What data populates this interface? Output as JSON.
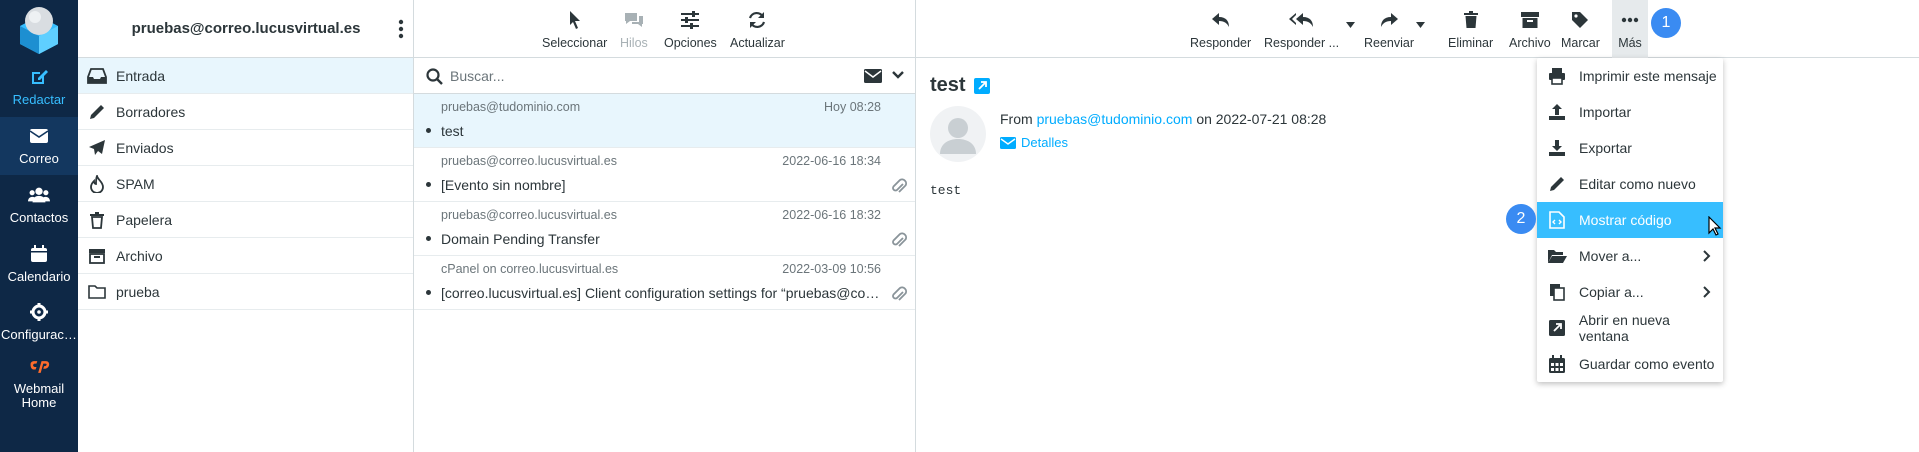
{
  "nav": {
    "compose": "Redactar",
    "mail": "Correo",
    "contacts": "Contactos",
    "calendar": "Calendario",
    "settings": "Configuraci...",
    "webmail_home": "Webmail Home"
  },
  "folders": {
    "account": "pruebas@correo.lucusvirtual.es",
    "items": [
      {
        "label": "Entrada",
        "icon": "inbox-icon"
      },
      {
        "label": "Borradores",
        "icon": "pencil-icon"
      },
      {
        "label": "Enviados",
        "icon": "paper-plane-icon"
      },
      {
        "label": "SPAM",
        "icon": "fire-icon"
      },
      {
        "label": "Papelera",
        "icon": "trash-icon"
      },
      {
        "label": "Archivo",
        "icon": "archive-icon"
      },
      {
        "label": "prueba",
        "icon": "folder-icon"
      }
    ]
  },
  "list_toolbar": {
    "select": "Seleccionar",
    "threads": "Hilos",
    "options": "Opciones",
    "refresh": "Actualizar"
  },
  "search": {
    "placeholder": "Buscar..."
  },
  "messages": [
    {
      "from": "pruebas@tudominio.com",
      "date": "Hoy 08:28",
      "subject": "test",
      "attachment": false
    },
    {
      "from": "pruebas@correo.lucusvirtual.es",
      "date": "2022-06-16 18:34",
      "subject": "[Evento sin nombre]",
      "attachment": true
    },
    {
      "from": "pruebas@correo.lucusvirtual.es",
      "date": "2022-06-16 18:32",
      "subject": "Domain Pending Transfer",
      "attachment": true
    },
    {
      "from": "cPanel on correo.lucusvirtual.es",
      "date": "2022-03-09 10:56",
      "subject": "[correo.lucusvirtual.es] Client configuration settings for “pruebas@correo.lucusvirtual.es”",
      "attachment": true
    }
  ],
  "reader_toolbar": {
    "reply": "Responder",
    "reply_all": "Responder ...",
    "forward": "Reenviar",
    "delete": "Eliminar",
    "archive": "Archivo",
    "mark": "Marcar",
    "more": "Más"
  },
  "message": {
    "title": "test",
    "from_prefix": "From",
    "from_address": "pruebas@tudominio.com",
    "on_text": "on 2022-07-21 08:28",
    "details": "Detalles",
    "body": "test"
  },
  "more_menu": [
    {
      "label": "Imprimir este mensaje",
      "icon": "printer-icon"
    },
    {
      "label": "Importar",
      "icon": "upload-icon"
    },
    {
      "label": "Exportar",
      "icon": "download-icon"
    },
    {
      "label": "Editar como nuevo",
      "icon": "pencil-icon"
    },
    {
      "label": "Mostrar código",
      "icon": "code-file-icon"
    },
    {
      "label": "Mover a...",
      "icon": "folder-open-icon"
    },
    {
      "label": "Copiar a...",
      "icon": "copy-icon"
    },
    {
      "label": "Abrir en nueva ventana",
      "icon": "external-window-icon"
    },
    {
      "label": "Guardar como evento",
      "icon": "calendar-icon"
    }
  ],
  "badges": {
    "step1": "1",
    "step2": "2"
  },
  "colors": {
    "nav_bg": "#0e2846",
    "accent": "#37beff",
    "link": "#00acff",
    "badge": "#3a8bf2"
  }
}
